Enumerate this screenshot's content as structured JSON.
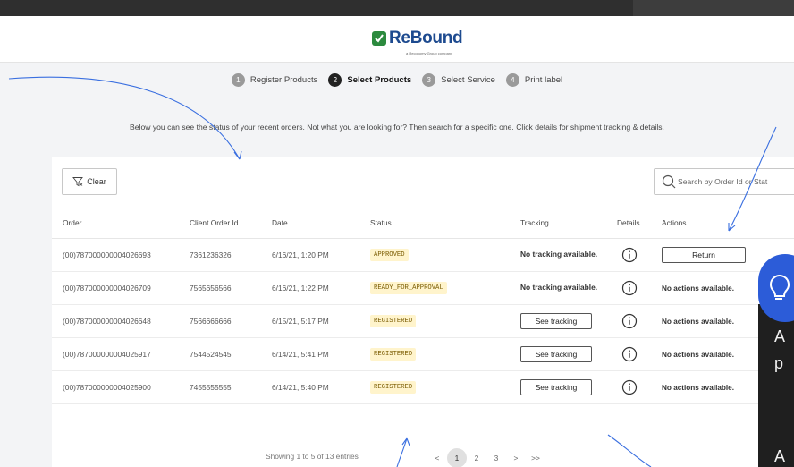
{
  "brand": {
    "name": "ReBound",
    "tagline": "a Reconomy Group company",
    "logo_icon": "rebound-logo-icon",
    "color": "#1d4a8f",
    "accent": "#2c8a3e"
  },
  "steps": [
    {
      "num": "1",
      "label": "Register Products",
      "active": false
    },
    {
      "num": "2",
      "label": "Select Products",
      "active": true
    },
    {
      "num": "3",
      "label": "Select Service",
      "active": false
    },
    {
      "num": "4",
      "label": "Print label",
      "active": false
    }
  ],
  "intro": "Below you can see the status of your recent orders. Not what you are looking for? Then search for a specific one. Click details for shipment tracking & details.",
  "toolbar": {
    "clear_label": "Clear",
    "search_placeholder": "Search by Order Id or Stat"
  },
  "table": {
    "headers": {
      "order": "Order",
      "client": "Client Order Id",
      "date": "Date",
      "status": "Status",
      "tracking": "Tracking",
      "details": "Details",
      "actions": "Actions"
    },
    "rows": [
      {
        "order": "(00)787000000004026693",
        "client": "7361236326",
        "date": "6/16/21, 1:20 PM",
        "status": "APPROVED",
        "tracking": "No tracking available.",
        "action": "Return"
      },
      {
        "order": "(00)787000000004026709",
        "client": "7565656566",
        "date": "6/16/21, 1:22 PM",
        "status": "READY_FOR_APPROVAL",
        "tracking": "No tracking available.",
        "action": "No actions available."
      },
      {
        "order": "(00)787000000004026648",
        "client": "7566666666",
        "date": "6/15/21, 5:17 PM",
        "status": "REGISTERED",
        "tracking": "See tracking",
        "action": "No actions available."
      },
      {
        "order": "(00)787000000004025917",
        "client": "7544524545",
        "date": "6/14/21, 5:41 PM",
        "status": "REGISTERED",
        "tracking": "See tracking",
        "action": "No actions available."
      },
      {
        "order": "(00)787000000004025900",
        "client": "7455555555",
        "date": "6/14/21, 5:40 PM",
        "status": "REGISTERED",
        "tracking": "See tracking",
        "action": "No actions available."
      }
    ]
  },
  "footer": {
    "showing": "Showing 1 to 5 of 13 entries",
    "pages": [
      "<",
      "1",
      "2",
      "3",
      ">",
      ">>"
    ],
    "current_page": "1"
  },
  "help": {
    "line1": "A",
    "line2": "p",
    "line3": "A",
    "icon": "lightbulb-icon",
    "color": "#2c5cd8"
  }
}
